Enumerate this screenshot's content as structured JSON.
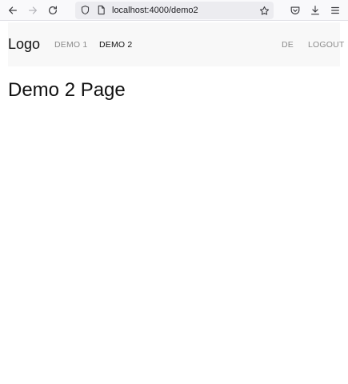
{
  "browser": {
    "url": "localhost:4000/demo2",
    "icons": {
      "back": "arrow-left-icon",
      "forward": "arrow-right-icon",
      "reload": "reload-icon",
      "site_info": "shield-icon",
      "page": "page-icon",
      "bookmark": "star-icon",
      "pocket": "pocket-icon",
      "downloads": "download-icon",
      "menu": "hamburger-menu-icon"
    }
  },
  "header": {
    "logo": "Logo",
    "nav": [
      {
        "label": "DEMO 1",
        "active": false
      },
      {
        "label": "DEMO 2",
        "active": true
      }
    ],
    "language": "DE",
    "logout": "LOGOUT"
  },
  "main": {
    "heading": "Demo 2 Page"
  },
  "colors": {
    "header_bg": "#f8f8f8",
    "nav_inactive": "#8a8a8a",
    "nav_active": "#111111"
  }
}
